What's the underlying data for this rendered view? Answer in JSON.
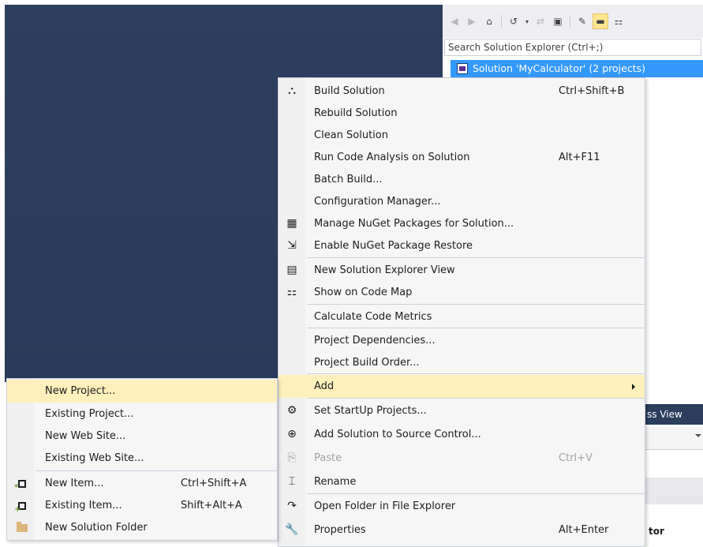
{
  "solution_explorer": {
    "toolbar_icons": [
      "back-icon",
      "forward-icon",
      "home-icon",
      "history-icon",
      "sync-icon",
      "collapse-all-icon",
      "properties-wrench-icon",
      "preview-icon",
      "code-map-icon"
    ],
    "search_placeholder": "Search Solution Explorer (Ctrl+;)",
    "selected_node": "Solution 'MyCalculator' (2 projects)"
  },
  "background_panel": {
    "tab_label": "ss View",
    "bold_text": "tor"
  },
  "context_menu": {
    "items": [
      {
        "icon": "build-icon",
        "glyph": "⛬",
        "label": "Build Solution",
        "shortcut": "Ctrl+Shift+B"
      },
      {
        "icon": "",
        "label": "Rebuild Solution",
        "shortcut": ""
      },
      {
        "icon": "",
        "label": "Clean Solution",
        "shortcut": ""
      },
      {
        "icon": "",
        "label": "Run Code Analysis on Solution",
        "shortcut": "Alt+F11"
      },
      {
        "icon": "",
        "label": "Batch Build...",
        "shortcut": ""
      },
      {
        "icon": "",
        "label": "Configuration Manager...",
        "shortcut": ""
      },
      {
        "icon": "nuget-icon",
        "glyph": "▦",
        "label": "Manage NuGet Packages for Solution...",
        "shortcut": ""
      },
      {
        "icon": "package-restore-icon",
        "glyph": "⇲",
        "label": "Enable NuGet Package Restore",
        "shortcut": ""
      },
      {
        "icon": "new-view-icon",
        "glyph": "▤",
        "label": "New Solution Explorer View",
        "shortcut": ""
      },
      {
        "icon": "code-map-icon",
        "glyph": "⚏",
        "label": "Show on Code Map",
        "shortcut": ""
      },
      {
        "icon": "",
        "label": "Calculate Code Metrics",
        "shortcut": ""
      },
      {
        "icon": "",
        "label": "Project Dependencies...",
        "shortcut": ""
      },
      {
        "icon": "",
        "label": "Project Build Order...",
        "shortcut": ""
      },
      {
        "icon": "",
        "label": "Add",
        "shortcut": "",
        "submenu": true
      },
      {
        "icon": "gear-icon",
        "glyph": "⚙",
        "label": "Set StartUp Projects...",
        "shortcut": ""
      },
      {
        "icon": "source-control-icon",
        "glyph": "⊕",
        "label": "Add Solution to Source Control...",
        "shortcut": ""
      },
      {
        "icon": "paste-icon",
        "glyph": "⎘",
        "label": "Paste",
        "shortcut": "Ctrl+V",
        "disabled": true
      },
      {
        "icon": "rename-icon",
        "glyph": "⌶",
        "label": "Rename",
        "shortcut": ""
      },
      {
        "icon": "open-folder-icon",
        "glyph": "↷",
        "label": "Open Folder in File Explorer",
        "shortcut": ""
      },
      {
        "icon": "wrench-icon",
        "glyph": "🔧",
        "label": "Properties",
        "shortcut": "Alt+Enter"
      }
    ]
  },
  "add_submenu": {
    "items": [
      {
        "icon": "",
        "label": "New Project...",
        "shortcut": ""
      },
      {
        "icon": "",
        "label": "Existing Project...",
        "shortcut": ""
      },
      {
        "icon": "",
        "label": "New Web Site...",
        "shortcut": ""
      },
      {
        "icon": "",
        "label": "Existing Web Site...",
        "shortcut": ""
      },
      {
        "icon": "new-item-icon",
        "label": "New Item...",
        "shortcut": "Ctrl+Shift+A"
      },
      {
        "icon": "existing-item-icon",
        "label": "Existing Item...",
        "shortcut": "Shift+Alt+A"
      },
      {
        "icon": "folder-icon",
        "label": "New Solution Folder",
        "shortcut": ""
      }
    ]
  }
}
